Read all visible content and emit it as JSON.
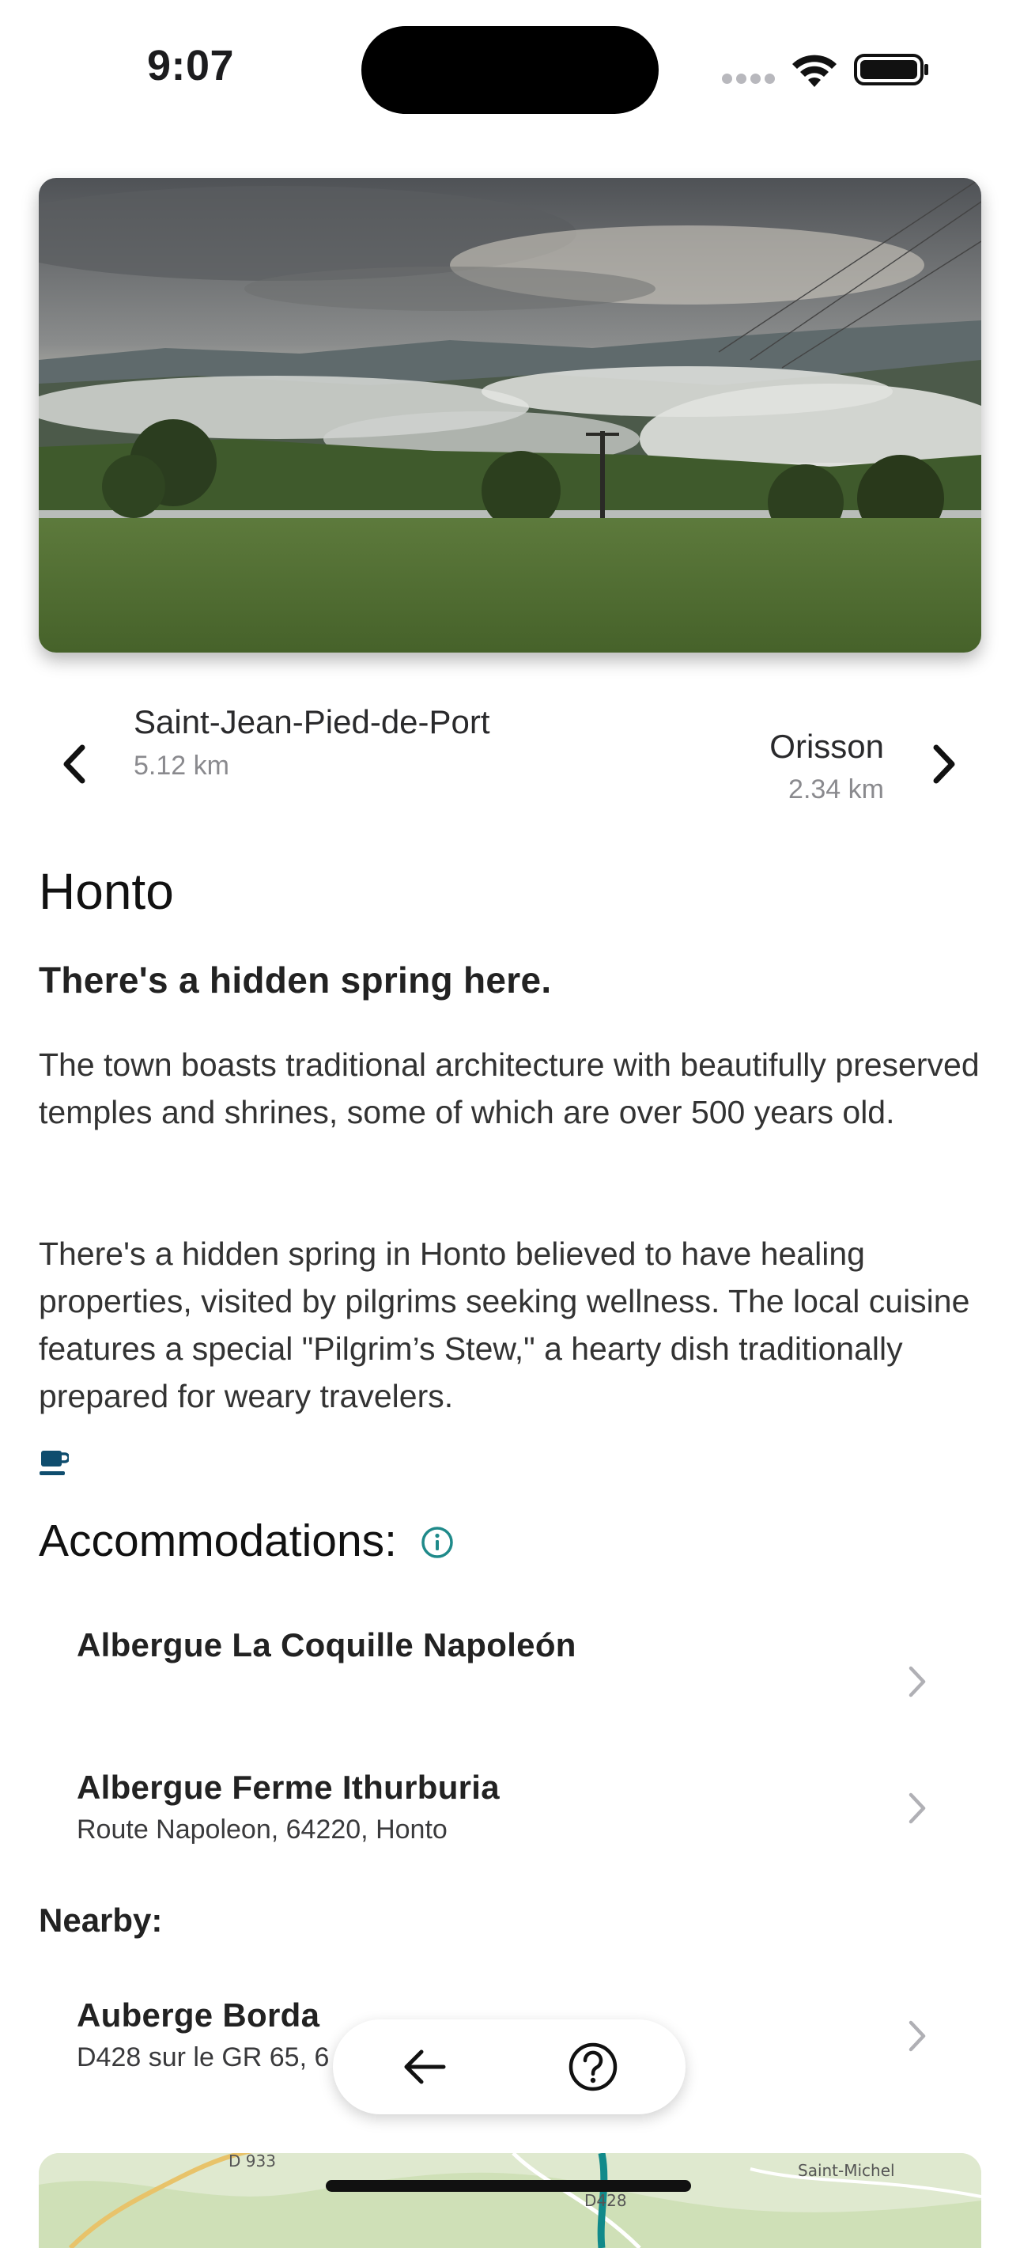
{
  "status_bar": {
    "time": "9:07"
  },
  "hero": {
    "image_description": "misty-valley-photo"
  },
  "stage_nav": {
    "previous": {
      "name": "Saint-Jean-Pied-de-Port",
      "distance": "5.12 km"
    },
    "next": {
      "name": "Orisson",
      "distance": "2.34 km"
    }
  },
  "town": {
    "title": "Honto",
    "headline": "There's a hidden spring here.",
    "paragraphs": [
      "The town boasts traditional architecture with beautifully preserved temples and shrines, some of which are over 500 years old.",
      "There's a hidden spring in Honto believed to have healing properties, visited by pilgrims seeking wellness. The local cuisine features a special \"Pilgrim’s Stew,\" a hearty dish traditionally prepared for weary travelers."
    ],
    "amenity_icon": "coffee-cup-icon"
  },
  "accommodations": {
    "title": "Accommodations:",
    "items": [
      {
        "name": "Albergue La Coquille Napoleón",
        "address": ""
      },
      {
        "name": "Albergue Ferme Ithurburia",
        "address": "Route Napoleon, 64220, Honto"
      }
    ]
  },
  "nearby": {
    "title": "Nearby:",
    "items": [
      {
        "name": "Auberge Borda",
        "address": "D428 sur le GR 65, 6"
      }
    ]
  },
  "map": {
    "labels": [
      "D 933",
      "Saint-Michel",
      "D428"
    ]
  },
  "colors": {
    "accent": "#1f8a8a",
    "cup_icon": "#0f4d6e",
    "text_primary": "#111111",
    "text_secondary": "#8a8a8e",
    "chevron": "#b0b0b5"
  }
}
